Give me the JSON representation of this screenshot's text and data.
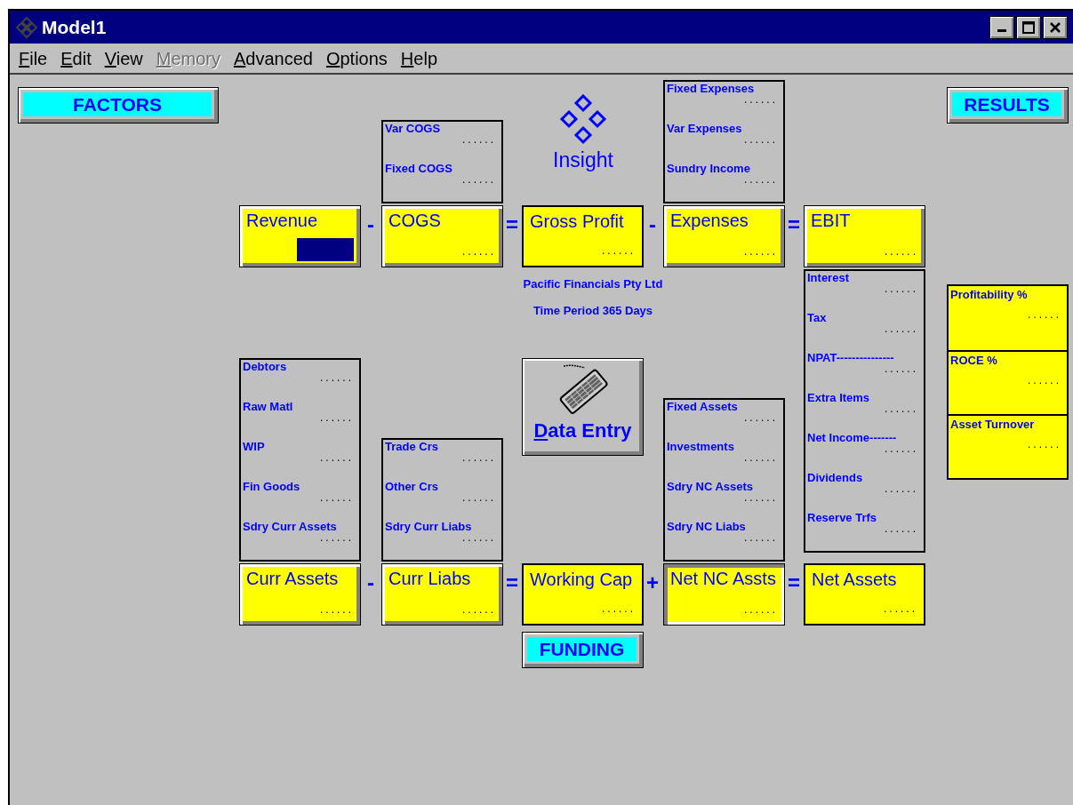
{
  "window": {
    "title": "Model1"
  },
  "menu": [
    {
      "label": "File",
      "disabled": false
    },
    {
      "label": "Edit",
      "disabled": false
    },
    {
      "label": "View",
      "disabled": false
    },
    {
      "label": "Memory",
      "disabled": true
    },
    {
      "label": "Advanced",
      "disabled": false
    },
    {
      "label": "Options",
      "disabled": false
    },
    {
      "label": "Help",
      "disabled": false
    }
  ],
  "factors_button": "FACTORS",
  "results_button": "RESULTS",
  "funding_button": "FUNDING",
  "logo": {
    "text": "Insight"
  },
  "company": "Pacific Financials Pty Ltd",
  "period": "Time Period 365 Days",
  "data_entry": {
    "label": "Data Entry"
  },
  "rows": [
    {
      "operators": [
        "-",
        "=",
        "-",
        "="
      ],
      "boxes": [
        {
          "label": "Revenue",
          "kind": "raised",
          "highlighted": true
        },
        {
          "label": "COGS",
          "kind": "raised",
          "highlighted": false,
          "value": "......",
          "details": [
            {
              "label": "Var COGS",
              "value": "......"
            },
            {
              "label": "Fixed COGS",
              "value": "......"
            }
          ]
        },
        {
          "label": "Gross Profit",
          "kind": "flat",
          "highlighted": false,
          "value": "......"
        },
        {
          "label": "Expenses",
          "kind": "raised",
          "highlighted": false,
          "value": "......",
          "details": [
            {
              "label": "Fixed Expenses",
              "value": "......"
            },
            {
              "label": "Var Expenses",
              "value": "......"
            },
            {
              "label": "Sundry Income",
              "value": "......"
            }
          ]
        },
        {
          "label": "EBIT",
          "kind": "raised",
          "highlighted": false,
          "value": "......",
          "details": [
            {
              "label": "Interest",
              "value": "......"
            },
            {
              "label": "Tax",
              "value": "......"
            },
            {
              "label": "NPAT---------------",
              "value": "......"
            },
            {
              "label": "Extra Items",
              "value": "......"
            },
            {
              "label": "Net Income-------",
              "value": "......"
            },
            {
              "label": "Dividends",
              "value": "......"
            },
            {
              "label": "Reserve Trfs",
              "value": "......"
            }
          ]
        }
      ]
    },
    {
      "operators": [
        "-",
        "=",
        "+",
        "="
      ],
      "boxes": [
        {
          "label": "Curr Assets",
          "kind": "raised",
          "highlighted": false,
          "value": "......",
          "details": [
            {
              "label": "Debtors",
              "value": "......"
            },
            {
              "label": "Raw Matl",
              "value": "......"
            },
            {
              "label": "WIP",
              "value": "......"
            },
            {
              "label": "Fin Goods",
              "value": "......"
            },
            {
              "label": "Sdry Curr Assets",
              "value": "......"
            }
          ]
        },
        {
          "label": "Curr Liabs",
          "kind": "raised",
          "highlighted": false,
          "value": "......",
          "details": [
            {
              "label": "Trade Crs",
              "value": "......"
            },
            {
              "label": "Other Crs",
              "value": "......"
            },
            {
              "label": "Sdry Curr Liabs",
              "value": "......"
            }
          ]
        },
        {
          "label": "Working Cap",
          "kind": "flat",
          "highlighted": false,
          "value": "......"
        },
        {
          "label": "Net NC Assts",
          "kind": "pressed",
          "highlighted": false,
          "value": "......",
          "details": [
            {
              "label": "Fixed Assets",
              "value": "......"
            },
            {
              "label": "Investments",
              "value": "......"
            },
            {
              "label": "Sdry NC Assets",
              "value": "......"
            },
            {
              "label": "Sdry NC Liabs",
              "value": "......"
            }
          ]
        },
        {
          "label": "Net Assets",
          "kind": "flat",
          "highlighted": false,
          "value": "......"
        }
      ]
    }
  ],
  "results": [
    {
      "label": "Profitability %",
      "value": "......"
    },
    {
      "label": "ROCE %",
      "value": "......"
    },
    {
      "label": "Asset Turnover",
      "value": "......"
    }
  ]
}
